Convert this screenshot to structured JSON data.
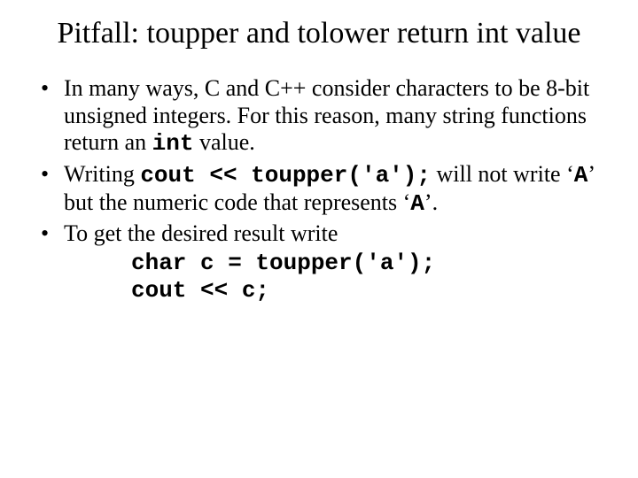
{
  "title": "Pitfall: toupper and tolower return int value",
  "bullets": {
    "b1_pre": "In many ways, C and C++ consider characters to be 8-bit unsigned integers.  For this reason, many string functions return an ",
    "b1_code": "int",
    "b1_post": " value.",
    "b2_pre": "Writing ",
    "b2_code": "cout << toupper('a');",
    "b2_mid": " will not write ‘",
    "b2_A1": "A",
    "b2_mid2": "’ but the numeric code that represents ‘",
    "b2_A2": "A",
    "b2_post": "’.",
    "b3": "To get the desired result write"
  },
  "code_line1": "char c = toupper('a');",
  "code_line2": "cout << c;"
}
